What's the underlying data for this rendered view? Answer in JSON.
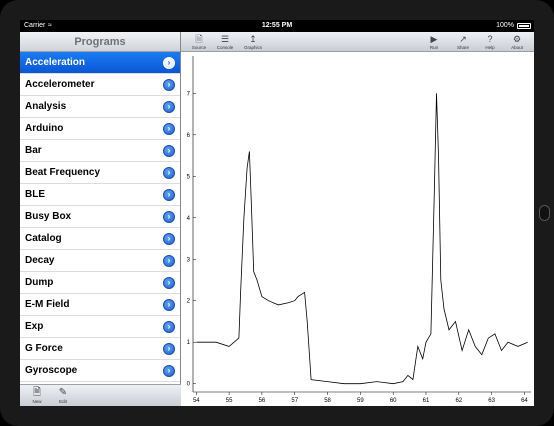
{
  "status": {
    "carrier": "Carrier",
    "time": "12:55 PM",
    "battery": "100%"
  },
  "programs": {
    "title": "Programs",
    "items": [
      {
        "label": "Acceleration",
        "selected": true
      },
      {
        "label": "Accelerometer"
      },
      {
        "label": "Analysis"
      },
      {
        "label": "Arduino"
      },
      {
        "label": "Bar"
      },
      {
        "label": "Beat Frequency"
      },
      {
        "label": "BLE"
      },
      {
        "label": "Busy Box"
      },
      {
        "label": "Catalog"
      },
      {
        "label": "Decay"
      },
      {
        "label": "Dump"
      },
      {
        "label": "E-M Field"
      },
      {
        "label": "Exp"
      },
      {
        "label": "G Force"
      },
      {
        "label": "Gyroscope"
      }
    ],
    "toolbar": {
      "new_label": "New",
      "edit_label": "Edit"
    }
  },
  "toolbar": {
    "source": "Source",
    "console": "Console",
    "graphics": "Graphics",
    "run": "Run",
    "share": "Share",
    "help": "Help",
    "about": "About"
  },
  "icons": {
    "source": "document-icon",
    "console": "console-icon",
    "graphics": "chart-icon",
    "run": "play-icon",
    "share": "share-icon",
    "help": "help-icon",
    "about": "gear-icon",
    "new": "new-document-icon",
    "edit": "edit-icon",
    "disclosure": "chevron-right-icon"
  },
  "chart_data": {
    "type": "line",
    "xlim": [
      53.9,
      64.2
    ],
    "ylim": [
      -0.2,
      7.9
    ],
    "xticks": [
      54,
      55,
      56,
      57,
      58,
      59,
      60,
      61,
      62,
      63,
      64
    ],
    "yticks": [
      0,
      1,
      2,
      3,
      4,
      5,
      6,
      7
    ],
    "series": [
      {
        "x": [
          54.0,
          54.6,
          55.0,
          55.3,
          55.35,
          55.45,
          55.55,
          55.62,
          55.68,
          55.75,
          55.85,
          56.0,
          56.2,
          56.5,
          56.8,
          57.0,
          57.1,
          57.3,
          57.38,
          57.5,
          58.0,
          58.5,
          59.0,
          59.5,
          60.0,
          60.3,
          60.45,
          60.6,
          60.75,
          60.9,
          61.0,
          61.15,
          61.25,
          61.32,
          61.38,
          61.45,
          61.55,
          61.7,
          61.9,
          62.1,
          62.3,
          62.5,
          62.7,
          62.9,
          63.1,
          63.3,
          63.5,
          63.8,
          64.1
        ],
        "y": [
          1.0,
          1.0,
          0.9,
          1.1,
          2.2,
          4.0,
          5.2,
          5.6,
          4.3,
          2.7,
          2.5,
          2.1,
          2.0,
          1.9,
          1.95,
          2.0,
          2.1,
          2.2,
          1.5,
          0.1,
          0.05,
          0.0,
          0.0,
          0.05,
          0.0,
          0.05,
          0.2,
          0.1,
          0.9,
          0.6,
          1.0,
          1.2,
          4.5,
          7.0,
          5.5,
          2.5,
          1.8,
          1.3,
          1.5,
          0.8,
          1.3,
          0.9,
          0.7,
          1.1,
          1.2,
          0.8,
          1.0,
          0.9,
          1.0
        ]
      }
    ],
    "grid": false
  }
}
